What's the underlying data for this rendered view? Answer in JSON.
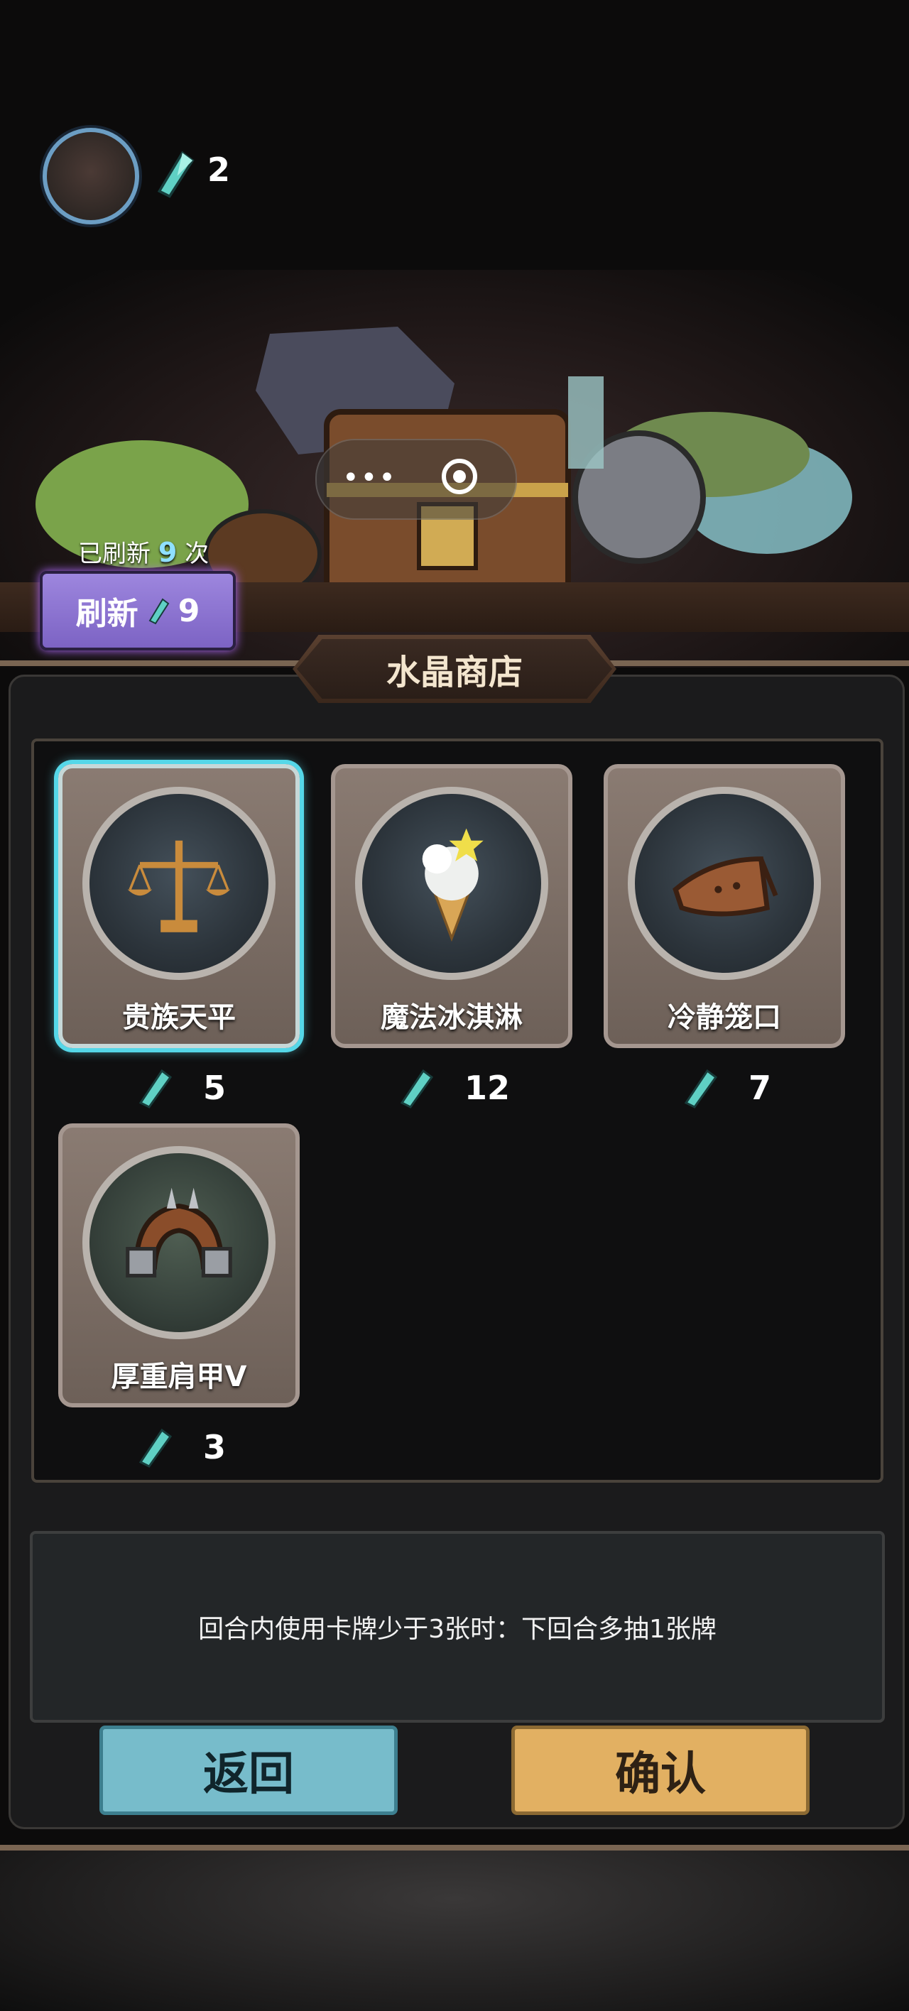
{
  "header": {
    "crystal_count": "2"
  },
  "refresh": {
    "info_prefix": "已刷新",
    "info_count": "9",
    "info_suffix": "次",
    "button_label": "刷新",
    "button_cost": "9"
  },
  "scene_overlay": {
    "dots_label": "•••"
  },
  "shop": {
    "title": "水晶商店",
    "items": [
      {
        "name": "贵族天平",
        "price": "5",
        "icon": "scale-icon",
        "selected": true
      },
      {
        "name": "魔法冰淇淋",
        "price": "12",
        "icon": "ice-cream-icon",
        "selected": false
      },
      {
        "name": "冷静笼口",
        "price": "7",
        "icon": "muzzle-icon",
        "selected": false
      },
      {
        "name": "厚重肩甲V",
        "price": "3",
        "icon": "shoulder-armor-icon",
        "selected": false
      }
    ]
  },
  "description": "回合内使用卡牌少于3张时：下回合多抽1张牌",
  "buttons": {
    "back": "返回",
    "confirm": "确认"
  },
  "colors": {
    "accent_cyan": "#55d7e8",
    "refresh_purple": "#9d86de",
    "back_button": "#77bccb",
    "confirm_button": "#e2b062"
  }
}
